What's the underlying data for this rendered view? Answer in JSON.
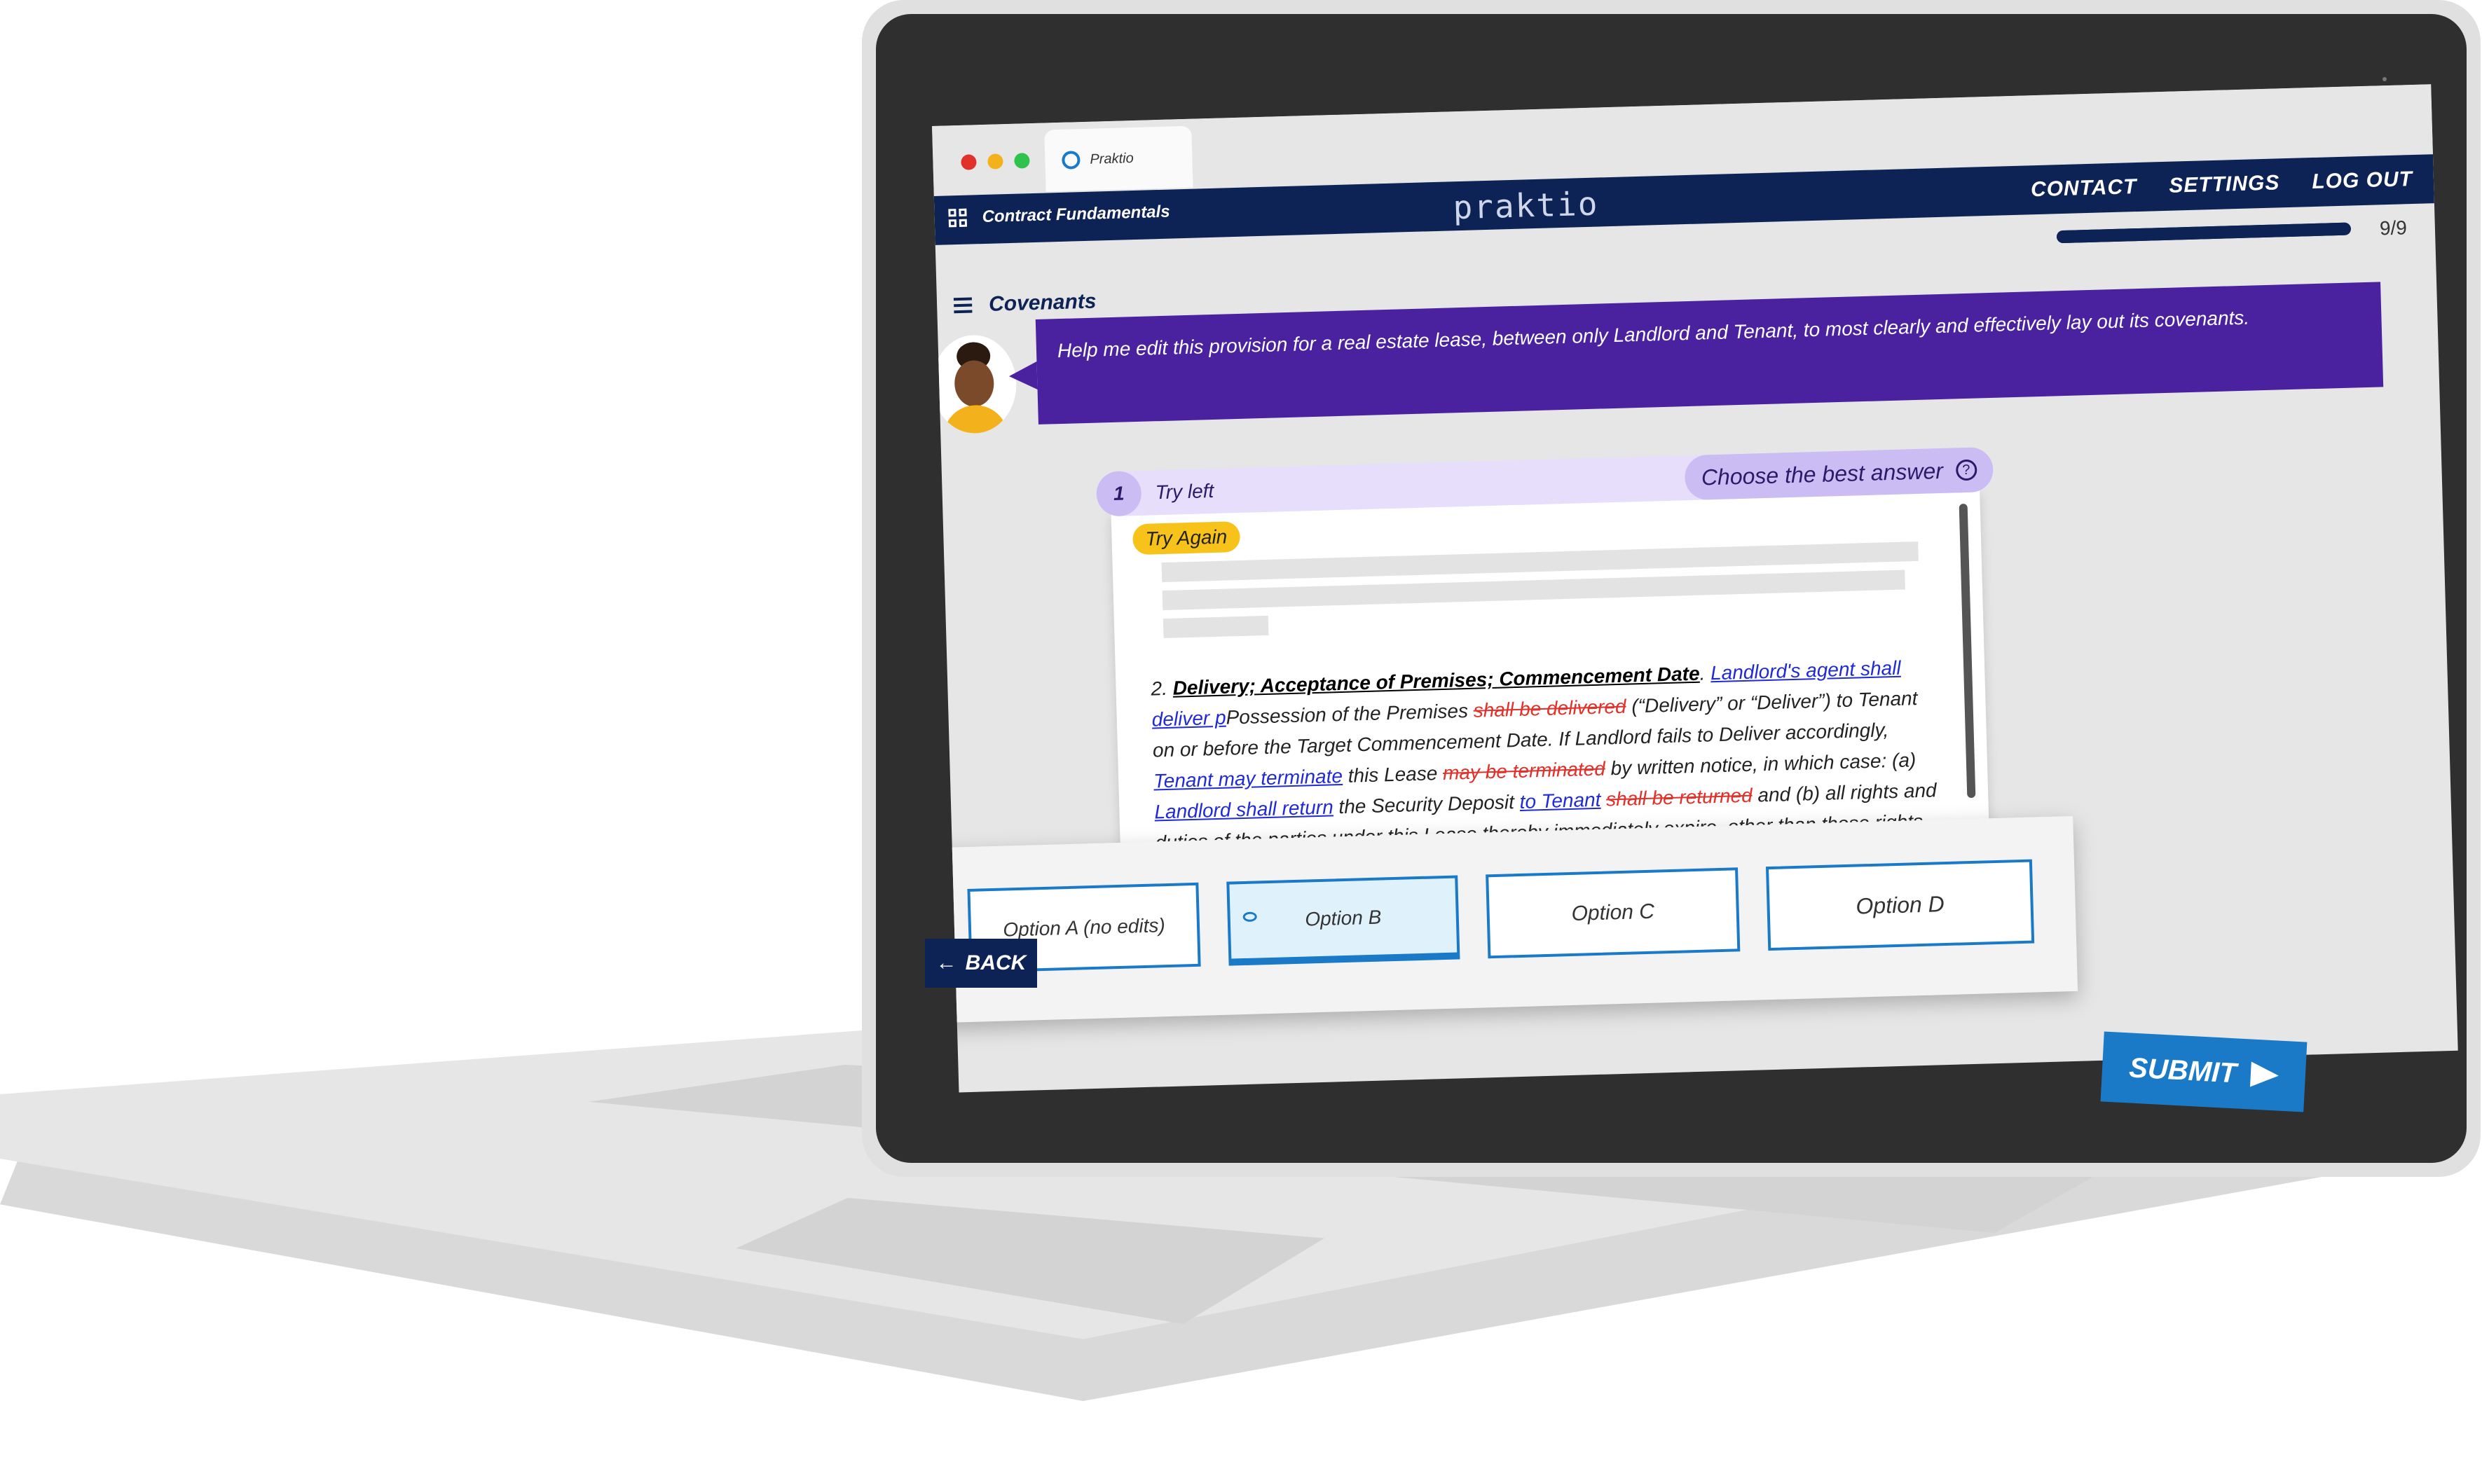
{
  "browser": {
    "tab_title": "Praktio"
  },
  "navbar": {
    "course_title": "Contract Fundamentals",
    "brand": "praktio",
    "links": [
      "CONTACT",
      "SETTINGS",
      "LOG OUT"
    ]
  },
  "progress": {
    "count": "9/9",
    "fraction": 1.0
  },
  "lesson": {
    "title": "Covenants"
  },
  "prompt": {
    "text": "Help me edit this provision for a real estate lease, between only Landlord and Tenant, to most clearly and effectively lay out its covenants."
  },
  "question": {
    "number": "1",
    "title": "Try left",
    "instruction": "Choose the best answer",
    "badge": "Try Again"
  },
  "document": {
    "heading": "Delivery; Acceptance of Premises; Commencement Date",
    "segments": [
      {
        "t": "2. ",
        "c": "plain"
      },
      {
        "t": "Delivery; Acceptance of Premises; Commencement Date",
        "c": "heading"
      },
      {
        "t": ". ",
        "c": "plain"
      },
      {
        "t": "Landlord's agent shall deliver p",
        "c": "ins"
      },
      {
        "t": "Possession of the Premises ",
        "c": "plain"
      },
      {
        "t": "shall be delivered",
        "c": "del"
      },
      {
        "t": " (“Delivery” or “Deliver”) to Tenant on or before the Target Commencement Date. If Landlord fails to Deliver accordingly, ",
        "c": "plain"
      },
      {
        "t": "Tenant may terminate",
        "c": "ins"
      },
      {
        "t": " this Lease ",
        "c": "plain"
      },
      {
        "t": "may be terminated",
        "c": "del"
      },
      {
        "t": " by written notice, in which case: (a) ",
        "c": "plain"
      },
      {
        "t": "Landlord shall return",
        "c": "ins"
      },
      {
        "t": " the Security Deposit ",
        "c": "plain"
      },
      {
        "t": "to Tenant",
        "c": "ins"
      },
      {
        "t": " ",
        "c": "plain"
      },
      {
        "t": "shall be returned",
        "c": "del"
      },
      {
        "t": " and (b) all rights and duties of the parties under this Lease thereby immediately expire, other than those rights and duties that expressly survive termination of this Lease.",
        "c": "plain"
      }
    ]
  },
  "options": [
    {
      "label": "Option A (no edits)"
    },
    {
      "label": "Option B",
      "selected": true
    },
    {
      "label": "Option C"
    },
    {
      "label": "Option D"
    }
  ],
  "actions": {
    "back": "BACK",
    "submit": "SUBMIT"
  },
  "colors": {
    "navy": "#0d2255",
    "purple": "#4a22a0",
    "blue": "#1a7ac7",
    "yellow": "#f7c21a"
  }
}
